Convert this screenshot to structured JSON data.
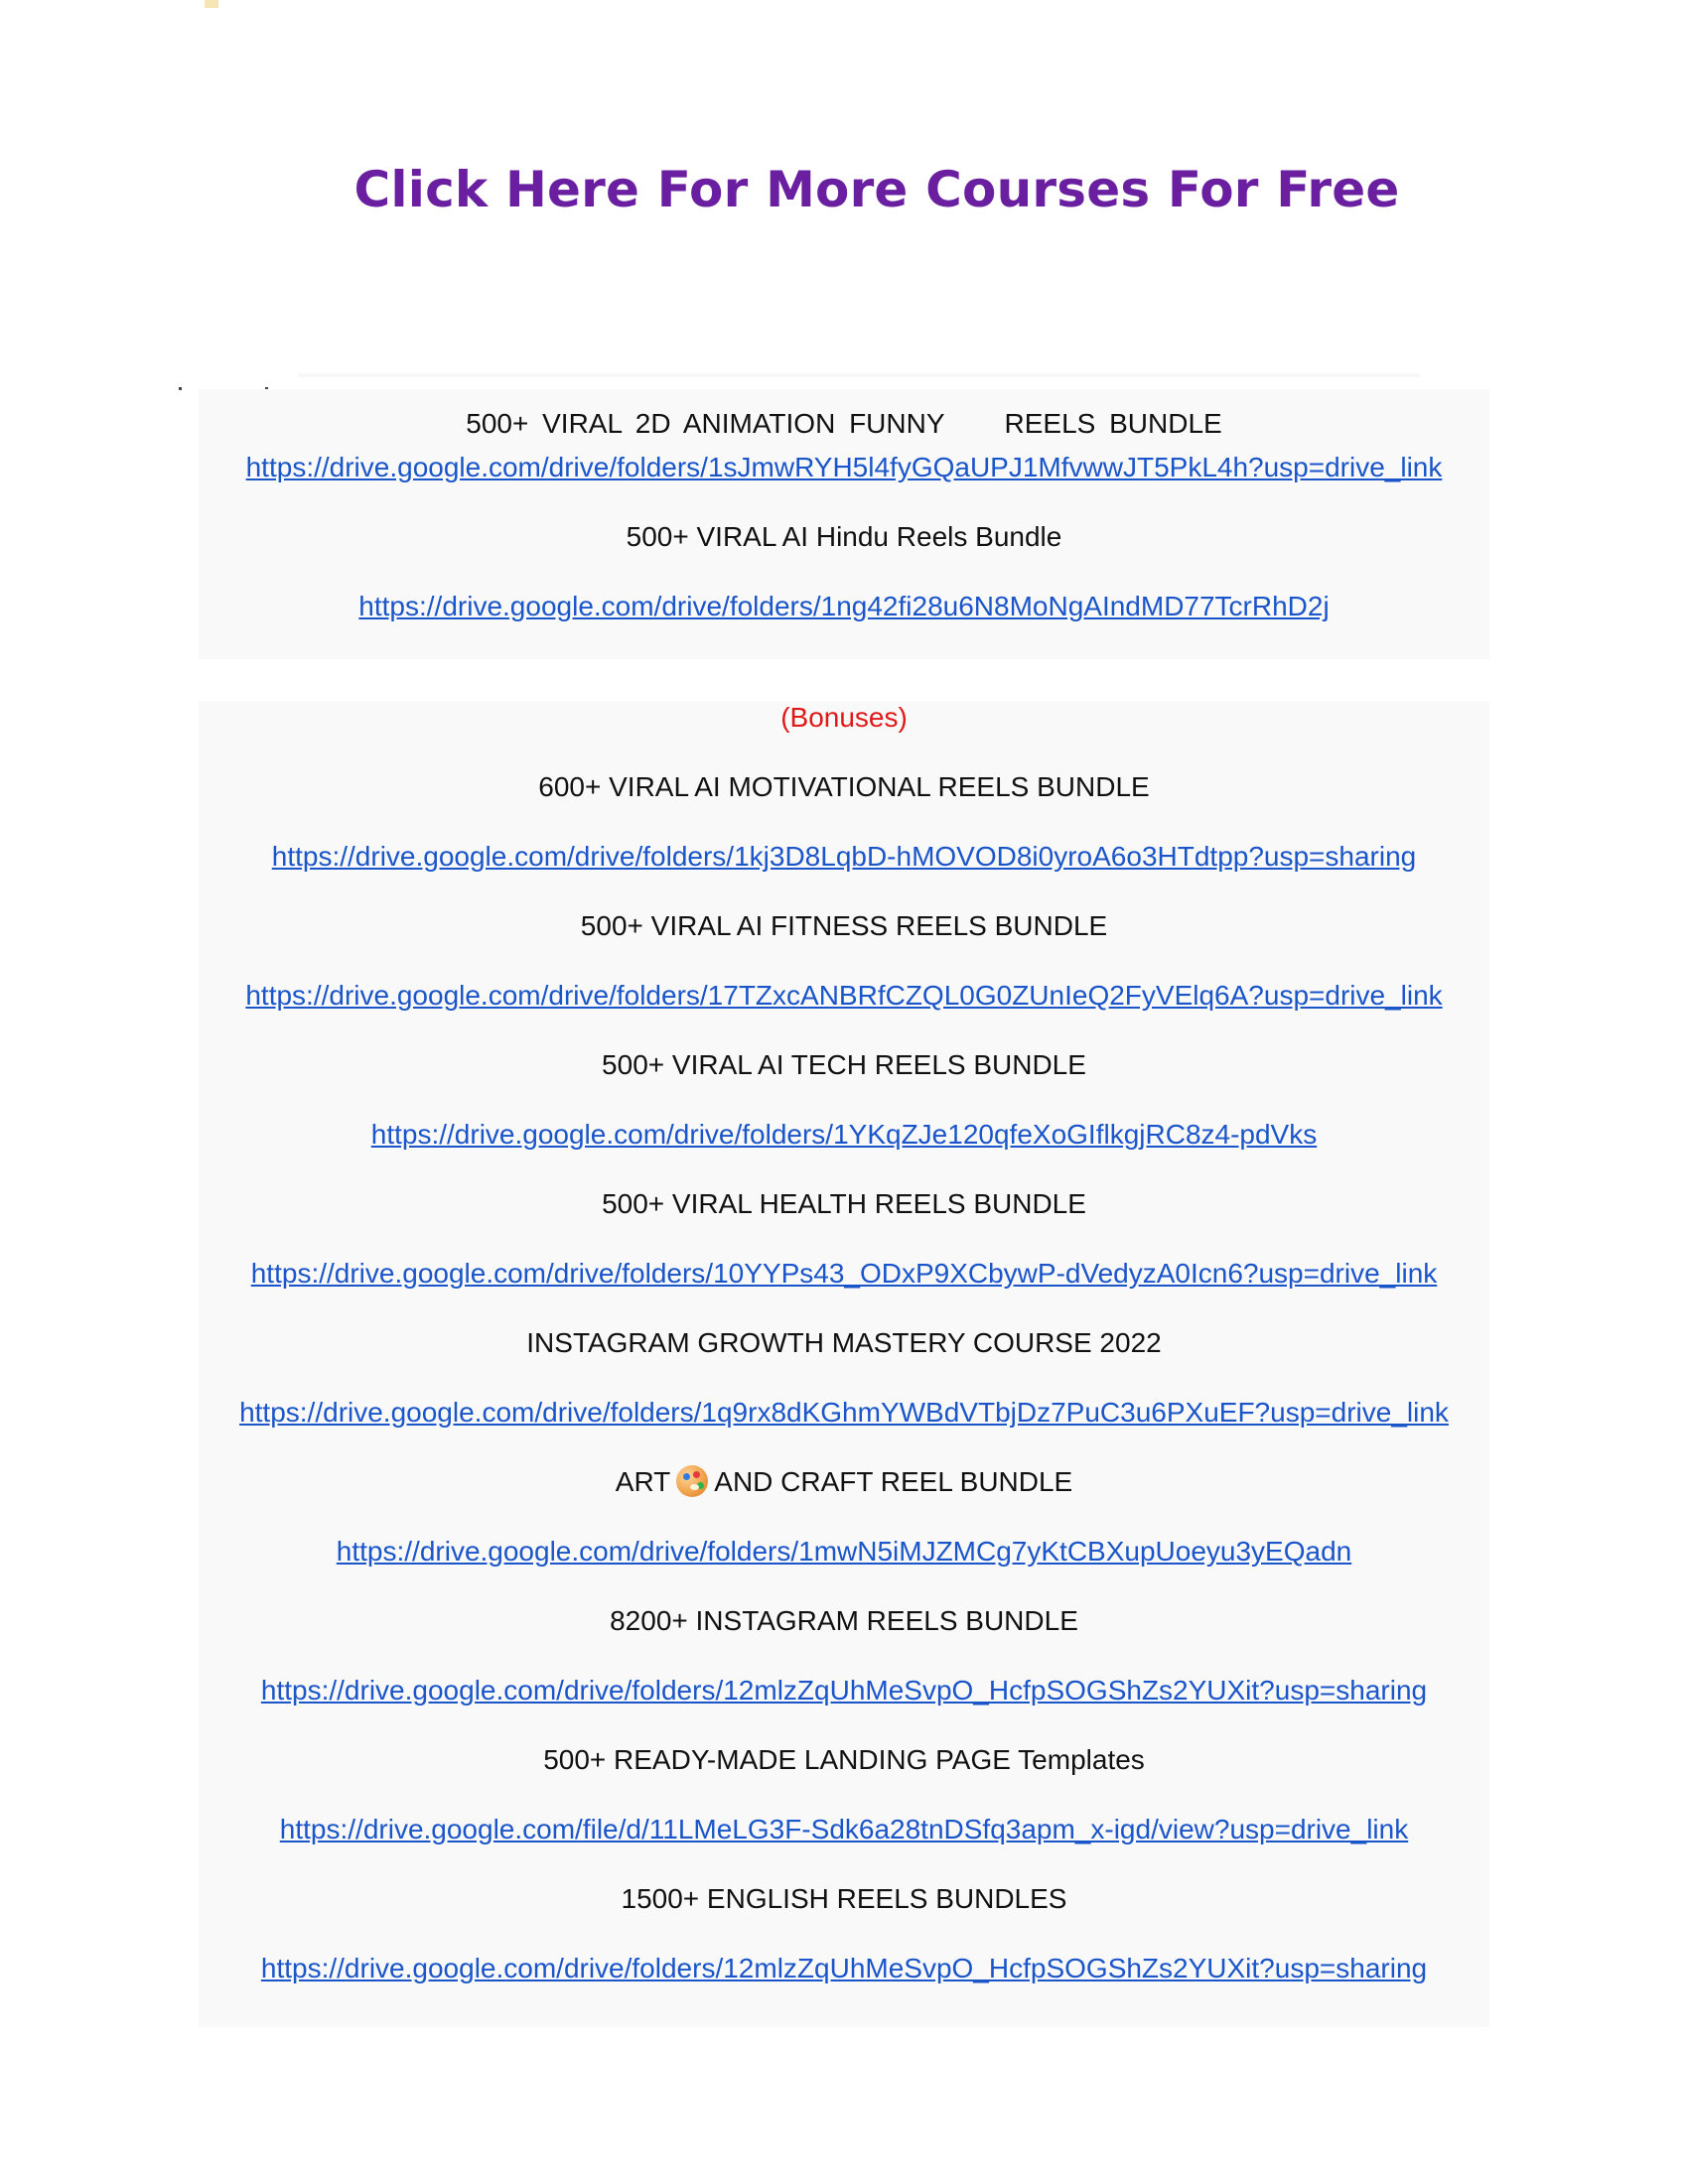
{
  "header": {
    "title": "Click Here For More Courses For Free"
  },
  "main_section": {
    "items": [
      {
        "title_parts": [
          "500+ VIRAL 2D ANIMATION FUNNY",
          "REELS BUNDLE"
        ],
        "url": "https://drive.google.com/drive/folders/1sJmwRYH5l4fyGQaUPJ1MfvwwJT5PkL4h?usp=drive_link"
      },
      {
        "title": "500+ VIRAL AI Hindu Reels Bundle",
        "url": "https://drive.google.com/drive/folders/1ng42fi28u6N8MoNgAIndMD77TcrRhD2j"
      }
    ]
  },
  "bonus_section": {
    "heading": "(Bonuses)",
    "items": [
      {
        "title": "600+ VIRAL AI MOTIVATIONAL REELS BUNDLE",
        "url": "https://drive.google.com/drive/folders/1kj3D8LqbD-hMOVOD8i0yroA6o3HTdtpp?usp=sharing"
      },
      {
        "title": "500+ VIRAL AI FITNESS REELS BUNDLE",
        "url": "https://drive.google.com/drive/folders/17TZxcANBRfCZQL0G0ZUnIeQ2FyVElq6A?usp=drive_link"
      },
      {
        "title": "500+ VIRAL AI TECH REELS BUNDLE",
        "url": "https://drive.google.com/drive/folders/1YKqZJe120qfeXoGIflkgjRC8z4-pdVks"
      },
      {
        "title": "500+ VIRAL HEALTH REELS BUNDLE",
        "url": "https://drive.google.com/drive/folders/10YYPs43_ODxP9XCbywP-dVedyzA0Icn6?usp=drive_link"
      },
      {
        "title": "INSTAGRAM GROWTH MASTERY COURSE 2022",
        "url": "https://drive.google.com/drive/folders/1q9rx8dKGhmYWBdVTbjDz7PuC3u6PXuEF?usp=drive_link"
      },
      {
        "title_before_icon": "ART",
        "icon": "artist-palette-icon",
        "title_after_icon": "AND CRAFT REEL BUNDLE",
        "url": "https://drive.google.com/drive/folders/1mwN5iMJZMCg7yKtCBXupUoeyu3yEQadn"
      },
      {
        "title": "8200+ INSTAGRAM REELS BUNDLE",
        "url": "https://drive.google.com/drive/folders/12mlzZqUhMeSvpO_HcfpSOGShZs2YUXit?usp=sharing"
      },
      {
        "title": "500+ READY-MADE LANDING PAGE Templates",
        "url": "https://drive.google.com/file/d/11LMeLG3F-Sdk6a28tnDSfq3apm_x-igd/view?usp=drive_link"
      },
      {
        "title": "1500+ ENGLISH REELS BUNDLES",
        "url": "https://drive.google.com/drive/folders/12mlzZqUhMeSvpO_HcfpSOGShZs2YUXit?usp=sharing"
      }
    ]
  },
  "colors": {
    "headline": "#6a1fa0",
    "link": "#1a55c9",
    "bonus_heading": "#e01818",
    "panel_background": "#f9f9f9"
  }
}
